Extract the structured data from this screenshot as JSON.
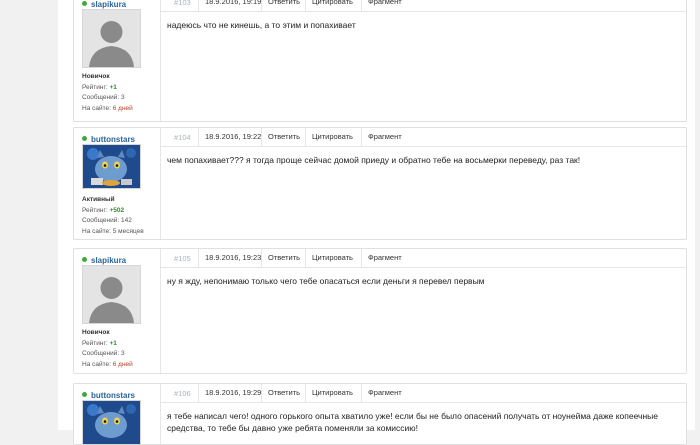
{
  "actions": {
    "reply": "Ответить",
    "quote": "Цитировать",
    "fragment": "Фрагмент"
  },
  "labels": {
    "rating": "Рейтинг:",
    "messages": "Сообщений:",
    "on_site": "На сайте:"
  },
  "posts": [
    {
      "num": "#103",
      "date": "18.9.2016, 19:19",
      "user": "slapikura",
      "rank": "Новичок",
      "rating": "+1",
      "messages": "3",
      "on_site": "6 дней",
      "text": "надеюсь что не кинешь, а то этим и попахивает"
    },
    {
      "num": "#104",
      "date": "18.9.2016, 19:22",
      "user": "buttonstars",
      "rank": "Активный",
      "rating": "+502",
      "messages": "142",
      "on_site": "5 месяцев",
      "text": "чем попахивает??? я тогда проще сейчас домой приеду и обратно тебе на восьмерки переведу, раз так!"
    },
    {
      "num": "#105",
      "date": "18.9.2016, 19:23",
      "user": "slapikura",
      "rank": "Новичок",
      "rating": "+1",
      "messages": "3",
      "on_site": "6 дней",
      "text": "ну я жду, непонимаю только чего тебе опасаться если деньги я перевел первым"
    },
    {
      "num": "#106",
      "date": "18.9.2016, 19:29",
      "user": "buttonstars",
      "text": "я тебе написал чего! одного горького опыта хватило уже! если бы не было опасений получать от ноунейма даже копеечные средства, то тебе бы давно уже ребята поменяли за комиссию!"
    }
  ],
  "colors": {
    "online": "#3fa83f",
    "username": "#2a6496",
    "rating_positive": "#2e8b2e",
    "on_site_new": "#c23b22"
  }
}
